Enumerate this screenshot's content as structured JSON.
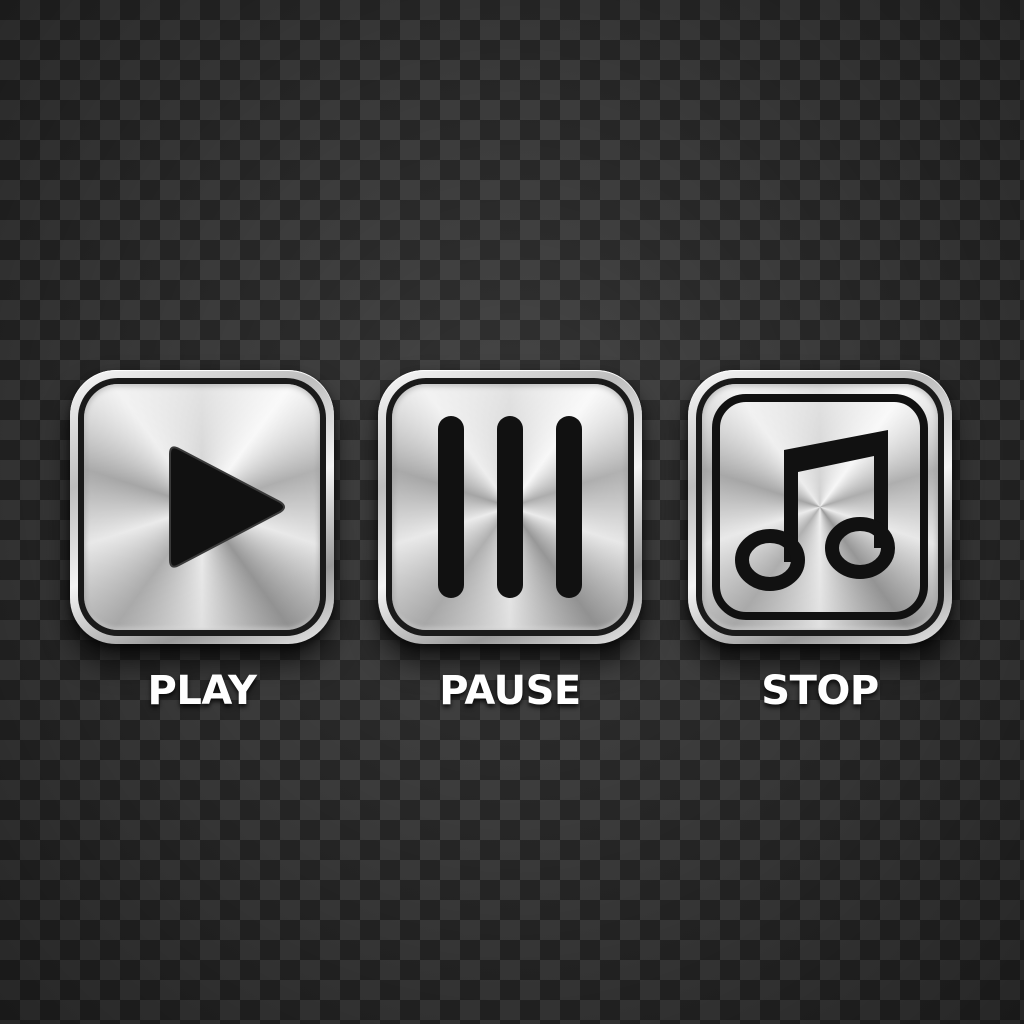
{
  "controls": [
    {
      "id": "play",
      "label": "PLAY",
      "icon": "play-triangle-icon"
    },
    {
      "id": "pause",
      "label": "PAUSE",
      "icon": "three-bars-icon"
    },
    {
      "id": "stop",
      "label": "STOP",
      "icon": "music-note-icon"
    }
  ],
  "colors": {
    "background_dark": "#262626",
    "background_light": "#3b3b3b",
    "metal": "#d9d9d9",
    "glyph": "#1a1a1a",
    "label": "#ffffff"
  }
}
